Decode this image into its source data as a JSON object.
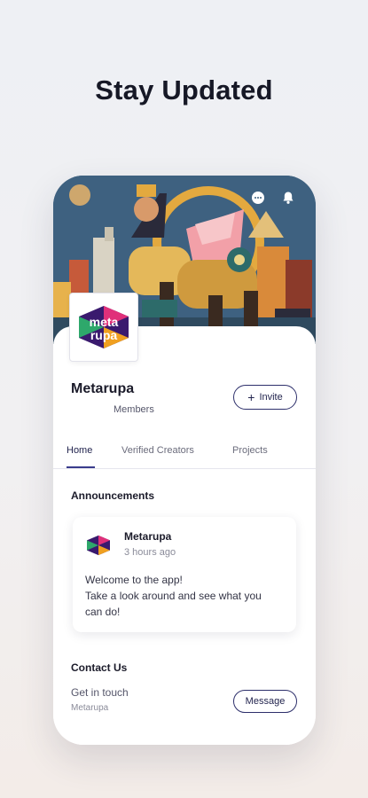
{
  "headline": "Stay Updated",
  "header_icons": [
    "chat-icon",
    "bell-icon"
  ],
  "site": {
    "name": "Metarupa",
    "logo_text_1": "meta",
    "logo_text_2": "rupa",
    "members_label": "Members",
    "invite_label": "Invite"
  },
  "tabs": [
    {
      "label": "Home",
      "active": true
    },
    {
      "label": "Verified Creators",
      "active": false
    },
    {
      "label": "Projects",
      "active": false
    }
  ],
  "announcements": {
    "title": "Announcements",
    "post": {
      "author": "Metarupa",
      "time": "3 hours ago",
      "body_lines": [
        "Welcome to the app!",
        "Take a look around and see what you",
        "can do!"
      ]
    }
  },
  "contact": {
    "title": "Contact Us",
    "subtitle": "Get in touch",
    "site": "Metarupa",
    "message_label": "Message"
  },
  "colors": {
    "accent": "#2d2f6b",
    "logo_pink": "#e0307a",
    "logo_purple": "#3a1a6e",
    "logo_green": "#2ea86b",
    "logo_orange": "#f0a020"
  }
}
